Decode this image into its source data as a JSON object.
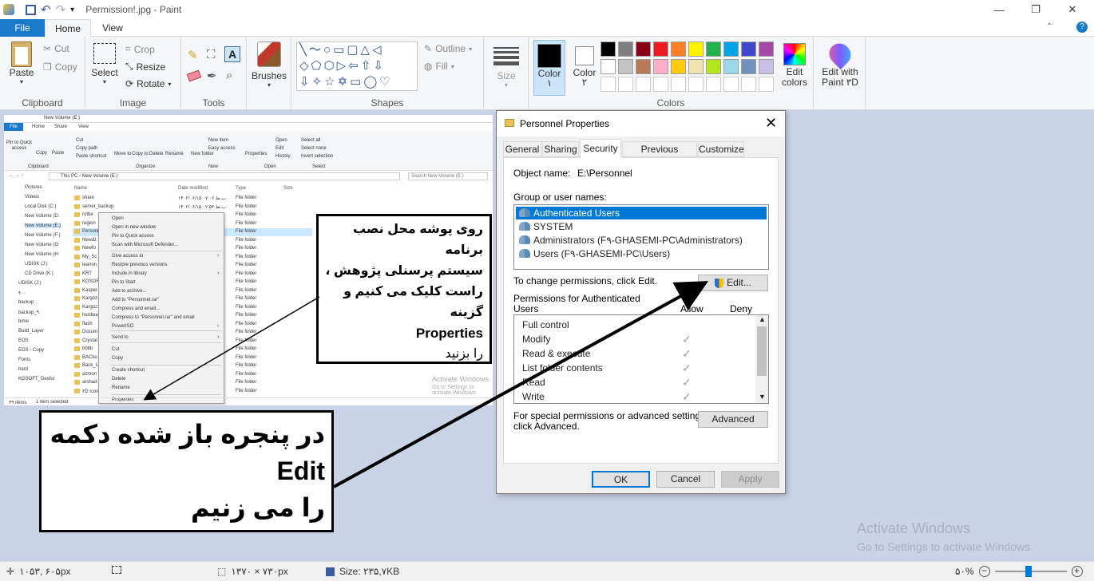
{
  "app": {
    "title": "Permission!.jpg - Paint",
    "tabs": [
      "File",
      "Home",
      "View"
    ]
  },
  "ribbon": {
    "clipboard": {
      "label": "Clipboard",
      "paste": "Paste",
      "cut": "Cut",
      "copy": "Copy"
    },
    "image": {
      "label": "Image",
      "select": "Select",
      "crop": "Crop",
      "resize": "Resize",
      "rotate": "Rotate"
    },
    "tools": {
      "label": "Tools"
    },
    "brushes": {
      "label": "Brushes"
    },
    "shapes": {
      "label": "Shapes",
      "outline": "Outline",
      "fill": "Fill"
    },
    "size": {
      "label": "Size"
    },
    "colors": {
      "label": "Colors",
      "color1": "Color",
      "color1_num": "۱",
      "color2": "Color",
      "color2_num": "۲",
      "edit": "Edit colors",
      "edit_paint3d": "Edit with Paint ۳D",
      "palette": [
        "#000000",
        "#7f7f7f",
        "#880015",
        "#ed1c24",
        "#ff7f27",
        "#fff200",
        "#22b14c",
        "#00a2e8",
        "#3f48cc",
        "#a349a4",
        "#ffffff",
        "#c3c3c3",
        "#b97a57",
        "#ffaec9",
        "#ffc90e",
        "#efe4b0",
        "#b5e61d",
        "#99d9ea",
        "#7092be",
        "#c8bfe7"
      ]
    }
  },
  "explorer": {
    "title": "New Volume (E:)",
    "tabs": [
      "File",
      "Home",
      "Share",
      "View"
    ],
    "toolbar": [
      "Pin to Quick access",
      "Copy",
      "Paste",
      "Cut",
      "Copy path",
      "Paste shortcut",
      "Move to",
      "Copy to",
      "Delete",
      "Rename",
      "New folder",
      "New item",
      "Easy access",
      "Properties",
      "Open",
      "Edit",
      "History",
      "Select all",
      "Select none",
      "Invert selection"
    ],
    "groups": [
      "Clipboard",
      "Organize",
      "New",
      "Open",
      "Select"
    ],
    "path": "This PC › New Volume (E:)",
    "search": "Search New Volume (E:)",
    "columns": [
      "Name",
      "Date modified",
      "Type",
      "Size"
    ],
    "nav": [
      "Pictures",
      "Videos",
      "Local Disk (C:)",
      "New Volume (D:",
      "New Volume (E:)",
      "New Volume (F:)",
      "New Volume (G:",
      "New Volume (H:",
      "UDISK (J:)",
      "CD Drive (K:)",
      "UDISK (J:)",
      "۴۰۰",
      "backup",
      "backup_۹",
      "bime",
      "Build_Layer",
      "EOS",
      "EOS - Copy",
      "Fonts",
      "hard",
      "KGSOFT_Desful"
    ],
    "rows": [
      "share",
      "server_backup",
      "rotbe",
      "region",
      "Personnel",
      "New&t",
      "Newfo",
      "My_Sc",
      "learnin",
      "KRT",
      "KGSOF",
      "Kasper",
      "Kargoz",
      "Kargoz",
      "hardwa",
      "flash",
      "Docum",
      "Crystal",
      "bbbb",
      "BACku",
      "Back_U",
      "azmon",
      "arshad",
      "۳D Icon"
    ],
    "row_dates": [
      "۱۴۰۲/۰۶/۱۵ ب.ظ ۰۷:۰۶",
      "۱۴۰۲/۰۶/۱۵ ب.ظ ۰۲:۵۳"
    ],
    "row_type": "File folder",
    "status_left": "۳۹ items",
    "status_mid": "1 item selected",
    "context_menu": [
      "Open",
      "Open in new window",
      "Pin to Quick access",
      "Scan with Microsoft Defender...",
      "Give access to",
      "Restore previous versions",
      "Include in library",
      "Pin to Start",
      "Add to archive...",
      "Add to \"Personnel.rar\"",
      "Compress and email...",
      "Compress to \"Personnel.rar\" and email",
      "PowerISO",
      "Send to",
      "Cut",
      "Copy",
      "Create shortcut",
      "Delete",
      "Rename",
      "Properties"
    ],
    "watermark1": "Activate Windows",
    "watermark2": "Go to Settings to activate Windows."
  },
  "dialog": {
    "title": "Personnel Properties",
    "tabs": [
      "General",
      "Sharing",
      "Security",
      "Previous Versions",
      "Customize"
    ],
    "object_label": "Object name:",
    "object_value": "E:\\Personnel",
    "group_label": "Group or user names:",
    "users": [
      "Authenticated Users",
      "SYSTEM",
      "Administrators (F۹-GHASEMI-PC\\Administrators)",
      "Users (F۹-GHASEMI-PC\\Users)"
    ],
    "change_text": "To change permissions, click Edit.",
    "edit_btn": "Edit...",
    "perm_label1": "Permissions for Authenticated",
    "perm_label2": "Users",
    "allow": "Allow",
    "deny": "Deny",
    "permissions": [
      "Full control",
      "Modify",
      "Read & execute",
      "List folder contents",
      "Read",
      "Write"
    ],
    "special1": "For special permissions or advanced settings,",
    "special2": "click Advanced.",
    "advanced_btn": "Advanced",
    "ok": "OK",
    "cancel": "Cancel",
    "apply": "Apply"
  },
  "callout1": {
    "line1": "روی پوشه محل نصب برنامه",
    "line2": "سیستم پرسنلی پژوهش ،",
    "line3": "راست کلیک می کنیم و گزینه",
    "line4": "Properties",
    "line5": "را بزنید"
  },
  "callout2": {
    "line1": "در پنجره باز شده دکمه",
    "line2": "Edit",
    "line3": "را می زنیم"
  },
  "watermark": {
    "line1": "Activate Windows",
    "line2": "Go to Settings to activate Windows."
  },
  "statusbar": {
    "pos": "۱۰۵۳, ۶۰۵px",
    "dims": "۱۳۷۰ × ۷۳۰px",
    "size": "Size: ۲۳۵,۷KB",
    "zoom": "۵۰%"
  }
}
